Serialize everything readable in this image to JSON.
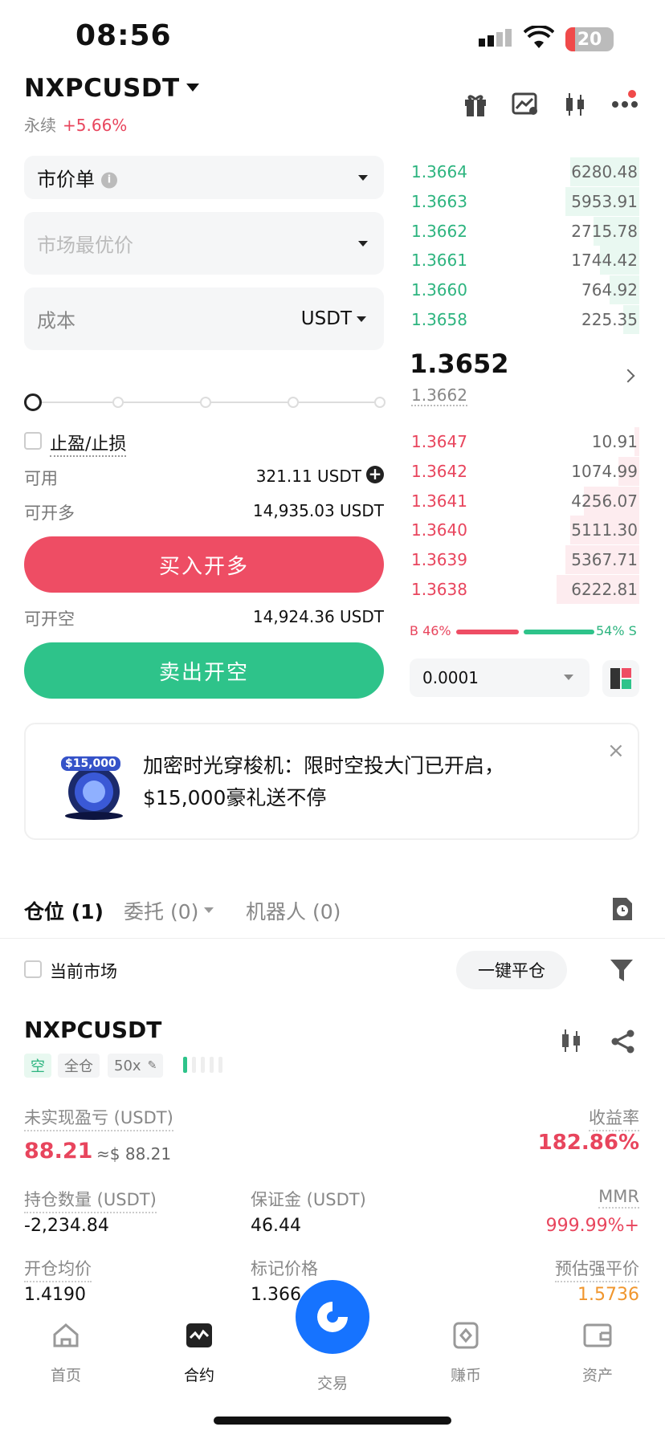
{
  "status": {
    "time": "08:56",
    "battery": "20"
  },
  "header": {
    "pair": "NXPCUSDT",
    "type": "永续",
    "change": "+5.66%"
  },
  "order_form": {
    "order_type": "市价单",
    "price_placeholder": "市场最优价",
    "cost_label": "成本",
    "cost_unit": "USDT",
    "tpsl_label": "止盈/止损",
    "available_label": "可用",
    "available_value": "321.11 USDT",
    "can_long_label": "可开多",
    "can_long_value": "14,935.03 USDT",
    "buy_button": "买入开多",
    "can_short_label": "可开空",
    "can_short_value": "14,924.36 USDT",
    "sell_button": "卖出开空"
  },
  "orderbook": {
    "asks": [
      {
        "price": "1.3664",
        "qty": "6280.48",
        "depth": 0.3
      },
      {
        "price": "1.3663",
        "qty": "5953.91",
        "depth": 0.32
      },
      {
        "price": "1.3662",
        "qty": "2715.78",
        "depth": 0.2
      },
      {
        "price": "1.3661",
        "qty": "1744.42",
        "depth": 0.17
      },
      {
        "price": "1.3660",
        "qty": "764.92",
        "depth": 0.13
      },
      {
        "price": "1.3658",
        "qty": "225.35",
        "depth": 0.07
      }
    ],
    "last_price": "1.3652",
    "mark_price": "1.3662",
    "bids": [
      {
        "price": "1.3647",
        "qty": "10.91",
        "depth": 0.02
      },
      {
        "price": "1.3642",
        "qty": "1074.99",
        "depth": 0.09
      },
      {
        "price": "1.3641",
        "qty": "4256.07",
        "depth": 0.24
      },
      {
        "price": "1.3640",
        "qty": "5111.30",
        "depth": 0.3
      },
      {
        "price": "1.3639",
        "qty": "5367.71",
        "depth": 0.32
      },
      {
        "price": "1.3638",
        "qty": "6222.81",
        "depth": 0.36
      }
    ],
    "buy_ratio": "B 46%",
    "sell_ratio": "54% S",
    "precision": "0.0001"
  },
  "banner": {
    "badge": "$15,000",
    "line1": "加密时光穿梭机：限时空投大门已开启，",
    "line2": "$15,000豪礼送不停",
    "close": "×"
  },
  "tabs": [
    {
      "label": "仓位 (1)"
    },
    {
      "label": "委托 (0)"
    },
    {
      "label": "机器人 (0)"
    }
  ],
  "filter": {
    "current_market": "当前市场",
    "close_all": "一键平仓"
  },
  "position": {
    "pair": "NXPCUSDT",
    "side": "空",
    "margin_mode": "全仓",
    "leverage": "50x",
    "upnl_label": "未实现盈亏 (USDT)",
    "upnl_value": "88.21",
    "upnl_usd": "≈$ 88.21",
    "roe_label": "收益率",
    "roe_value": "182.86%",
    "size_label": "持仓数量 (USDT)",
    "size_value": "-2,234.84",
    "margin_label": "保证金 (USDT)",
    "margin_value": "46.44",
    "mmr_label": "MMR",
    "mmr_value": "999.99%+",
    "entry_label": "开仓均价",
    "entry_value": "1.4190",
    "mark_label": "标记价格",
    "mark_value": "1.366",
    "liq_label": "预估强平价",
    "liq_value": "1.5736"
  },
  "nav": [
    {
      "label": "首页"
    },
    {
      "label": "合约"
    },
    {
      "label": "交易"
    },
    {
      "label": "赚币"
    },
    {
      "label": "资产"
    }
  ]
}
